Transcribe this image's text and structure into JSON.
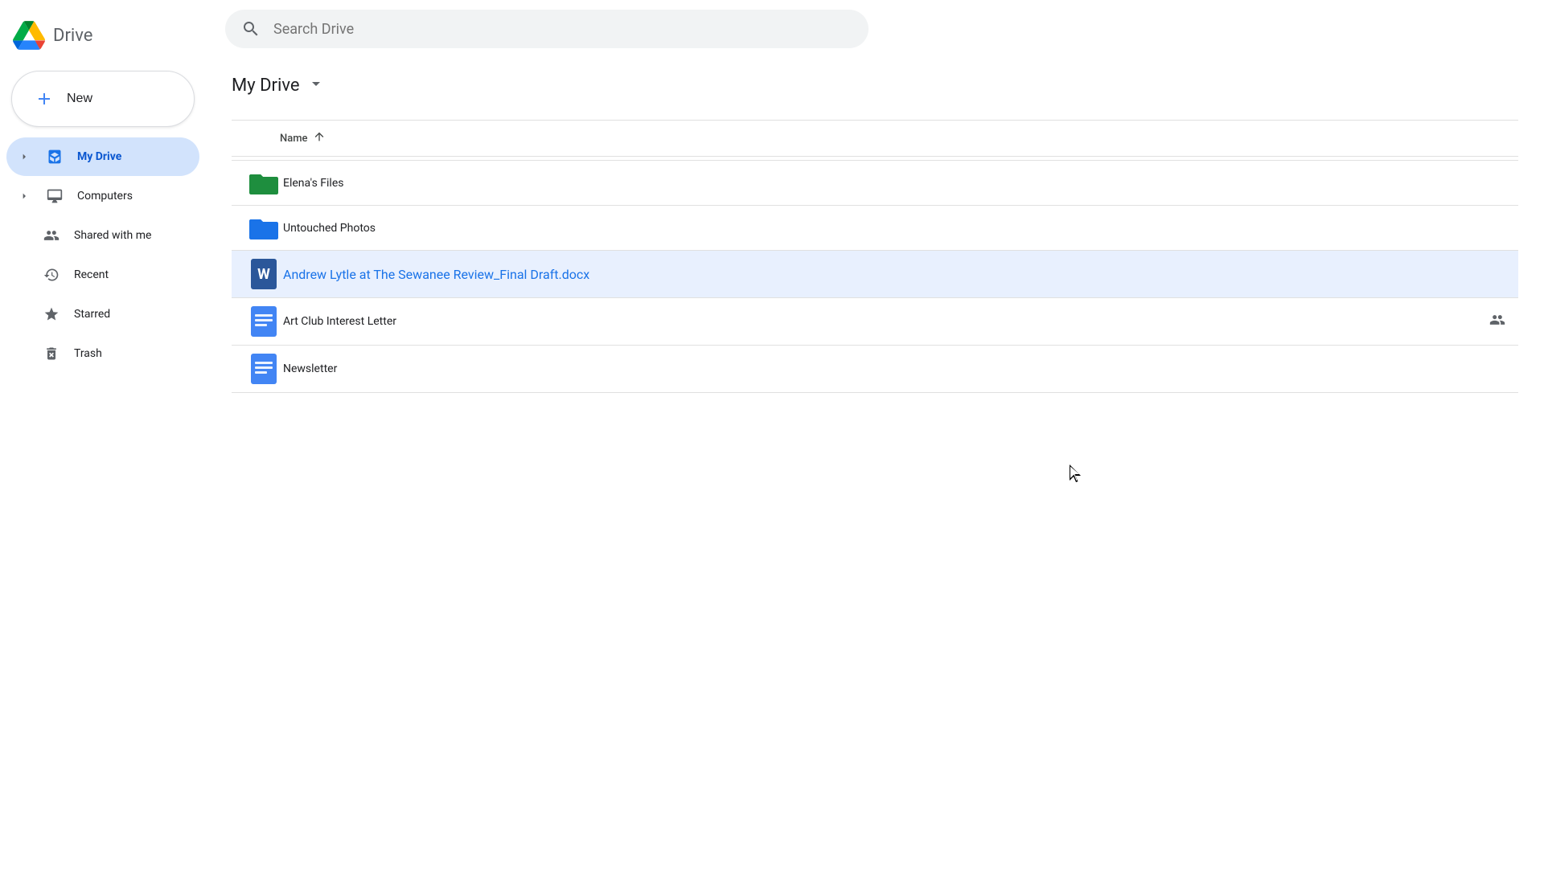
{
  "app": {
    "title": "Drive",
    "logo_alt": "Google Drive logo"
  },
  "sidebar": {
    "new_button_label": "New",
    "new_icon": "+",
    "items": [
      {
        "id": "my-drive",
        "label": "My Drive",
        "icon": "drive",
        "active": true,
        "has_chevron": true
      },
      {
        "id": "computers",
        "label": "Computers",
        "icon": "computer",
        "active": false,
        "has_chevron": true
      },
      {
        "id": "shared-with-me",
        "label": "Shared with me",
        "icon": "people",
        "active": false,
        "has_chevron": false
      },
      {
        "id": "recent",
        "label": "Recent",
        "icon": "clock",
        "active": false,
        "has_chevron": false
      },
      {
        "id": "starred",
        "label": "Starred",
        "icon": "star",
        "active": false,
        "has_chevron": false
      },
      {
        "id": "trash",
        "label": "Trash",
        "icon": "trash",
        "active": false,
        "has_chevron": false
      }
    ]
  },
  "search": {
    "placeholder": "Search Drive"
  },
  "main": {
    "drive_title": "My Drive",
    "sort_column": "Name",
    "sort_direction": "asc",
    "files": [
      {
        "id": "elenas-files",
        "name": "Elena's Files",
        "type": "folder-green",
        "shared": false,
        "selected": false
      },
      {
        "id": "untouched-photos",
        "name": "Untouched Photos",
        "type": "folder-blue",
        "shared": false,
        "selected": false
      },
      {
        "id": "andrew-lytle",
        "name": "Andrew Lytle at The Sewanee Review_Final Draft.docx",
        "type": "word",
        "shared": false,
        "selected": true
      },
      {
        "id": "art-club",
        "name": "Art Club Interest Letter",
        "type": "gdoc",
        "shared": true,
        "selected": false
      },
      {
        "id": "newsletter",
        "name": "Newsletter",
        "type": "gdoc",
        "shared": false,
        "selected": false
      }
    ]
  },
  "colors": {
    "accent_blue": "#1a73e8",
    "active_nav_bg": "#d2e3fc",
    "selected_row_bg": "#e8f0fe",
    "folder_green": "#1e8e3e",
    "folder_blue": "#1a73e8",
    "word_blue": "#2b579a"
  }
}
